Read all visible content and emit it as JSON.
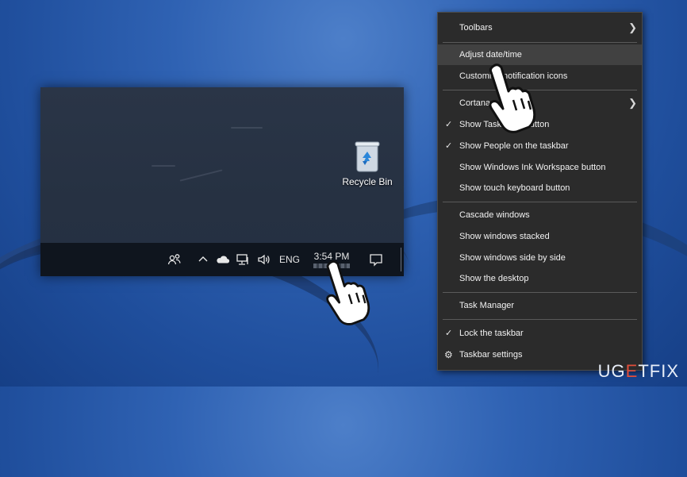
{
  "desktop": {
    "recycle_bin_label": "Recycle Bin"
  },
  "taskbar": {
    "people_icon": "people-icon",
    "tray_chevron_icon": "chevron-up-icon",
    "onedrive_icon": "cloud-icon",
    "network_icon": "network-icon",
    "volume_icon": "volume-icon",
    "language": "ENG",
    "clock_time": "3:54 PM",
    "action_center_icon": "action-center-icon"
  },
  "context_menu": {
    "items": [
      {
        "label": "Toolbars",
        "submenu": true
      },
      {
        "label": "Adjust date/time",
        "highlighted": true
      },
      {
        "label": "Customize notification icons"
      },
      {
        "label": "Cortana",
        "submenu": true
      },
      {
        "label": "Show Task View button",
        "checked": true
      },
      {
        "label": "Show People on the taskbar",
        "checked": true
      },
      {
        "label": "Show Windows Ink Workspace button"
      },
      {
        "label": "Show touch keyboard button"
      },
      {
        "label": "Cascade windows"
      },
      {
        "label": "Show windows stacked"
      },
      {
        "label": "Show windows side by side"
      },
      {
        "label": "Show the desktop"
      },
      {
        "label": "Task Manager"
      },
      {
        "label": "Lock the taskbar",
        "checked": true
      },
      {
        "label": "Taskbar settings",
        "icon": "gear-icon"
      }
    ]
  },
  "watermark": {
    "part1": "UG",
    "accent": "E",
    "part2": "TFIX"
  },
  "colors": {
    "menu_bg": "#2b2b2b",
    "menu_highlight": "#414141",
    "taskbar_bg": "#0f151e",
    "accent": "#e04d3a"
  }
}
